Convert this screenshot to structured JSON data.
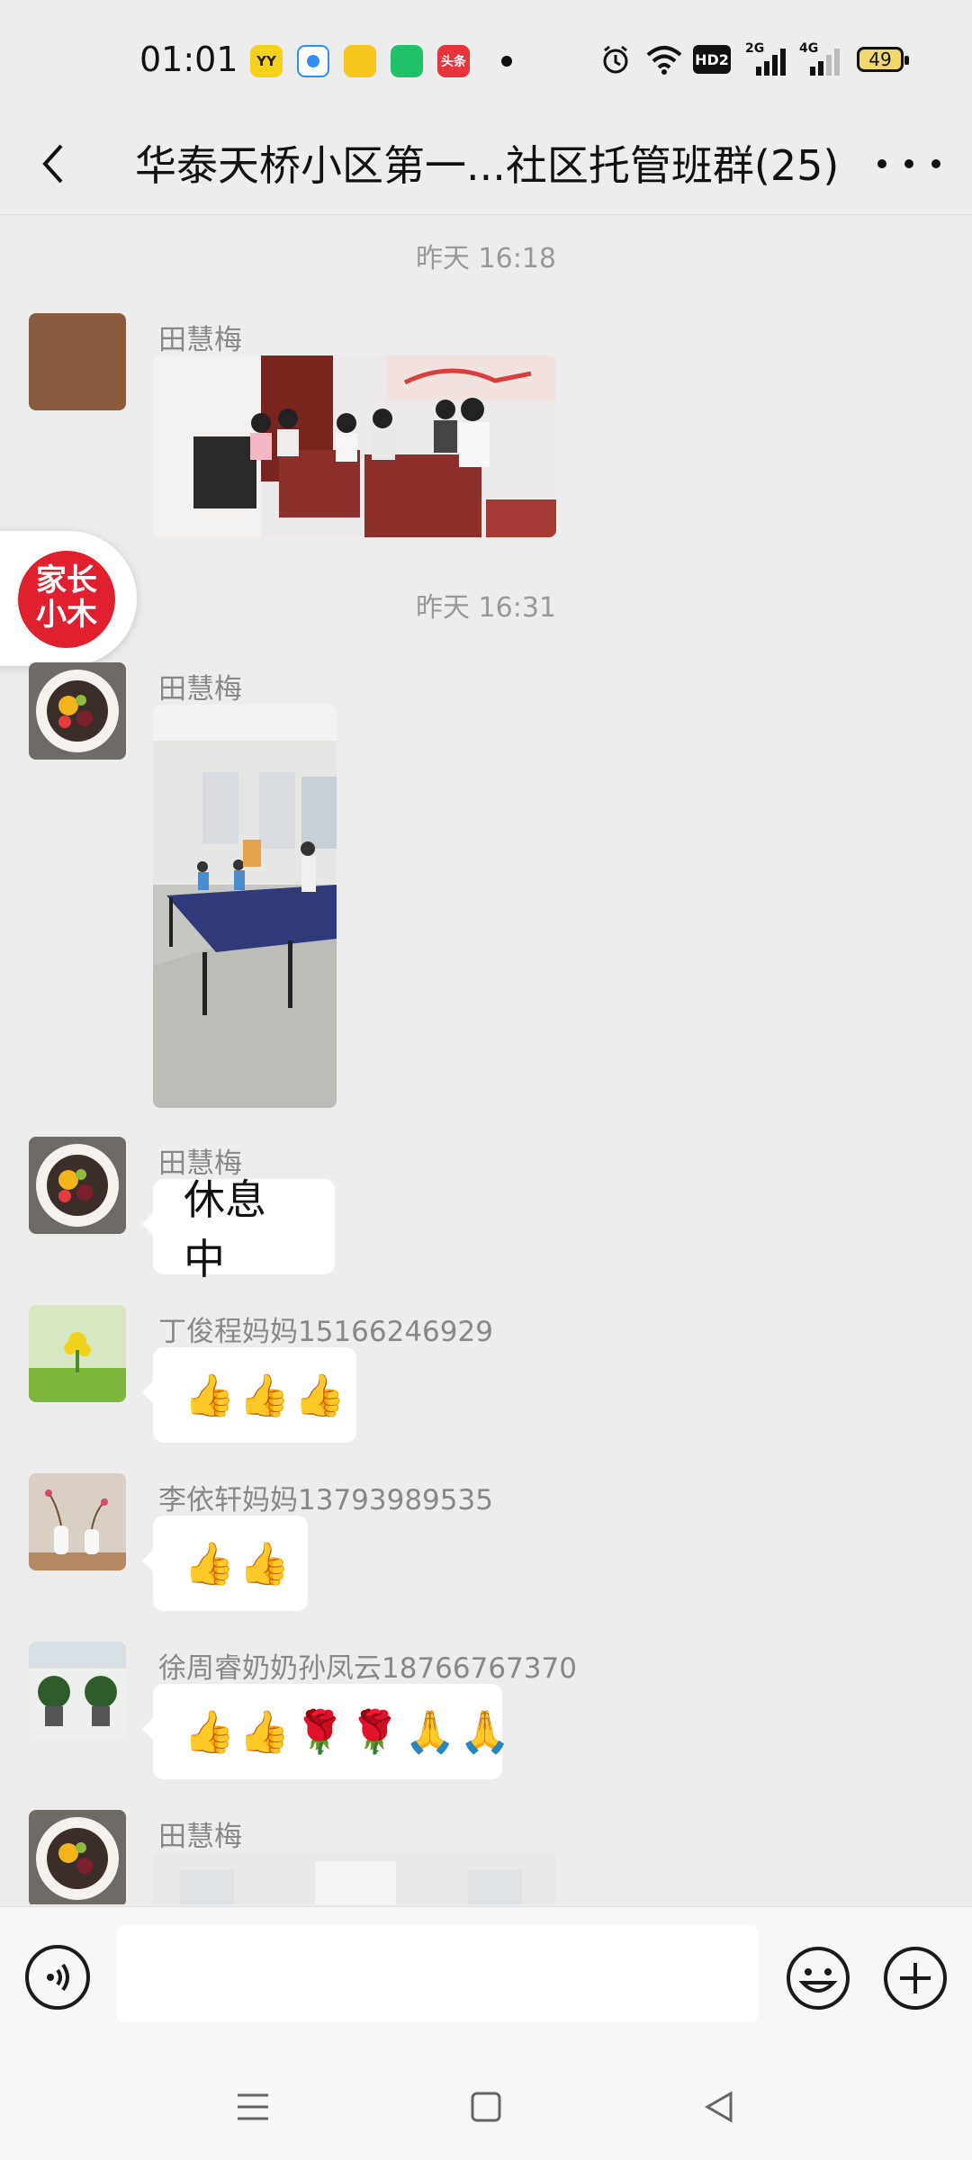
{
  "status_bar": {
    "time": "01:01",
    "apps": [
      {
        "name": "yy-app-icon",
        "label": "YY",
        "color": "#f6d21b"
      },
      {
        "name": "browser-app-icon",
        "label": "",
        "color": "#2e8ef5"
      },
      {
        "name": "notes-app-icon",
        "label": "",
        "color": "#f7c51c"
      },
      {
        "name": "store-app-icon",
        "label": "",
        "color": "#1fc16a"
      },
      {
        "name": "toutiao-app-icon",
        "label": "头条",
        "color": "#e8333a"
      }
    ],
    "network_1": "HD2",
    "network_2": "2G",
    "network_3": "4G",
    "battery": "49"
  },
  "header": {
    "title": "华泰天桥小区第一...社区托管班群(25)"
  },
  "floating_badge": {
    "text": "家长\n小木"
  },
  "messages": [
    {
      "type": "timestamp",
      "text": "昨天 16:18"
    },
    {
      "type": "image",
      "sender": "田慧梅"
    },
    {
      "type": "timestamp",
      "text": "昨天 16:31"
    },
    {
      "type": "image",
      "sender": "田慧梅"
    },
    {
      "type": "text",
      "sender": "田慧梅",
      "text": "休息中"
    },
    {
      "type": "emoji",
      "sender": "丁俊程妈妈15166246929",
      "text": "👍👍👍"
    },
    {
      "type": "emoji",
      "sender": "李依轩妈妈13793989535",
      "text": "👍👍"
    },
    {
      "type": "emoji",
      "sender": "徐周睿奶奶孙凤云18766767370",
      "text": "👍👍🌹🌹🙏🙏"
    },
    {
      "type": "image",
      "sender": "田慧梅"
    }
  ],
  "input": {
    "value": "",
    "placeholder": ""
  },
  "colors": {
    "background": "#ededed",
    "bubble": "#ffffff",
    "brand_red": "#e0212d"
  }
}
